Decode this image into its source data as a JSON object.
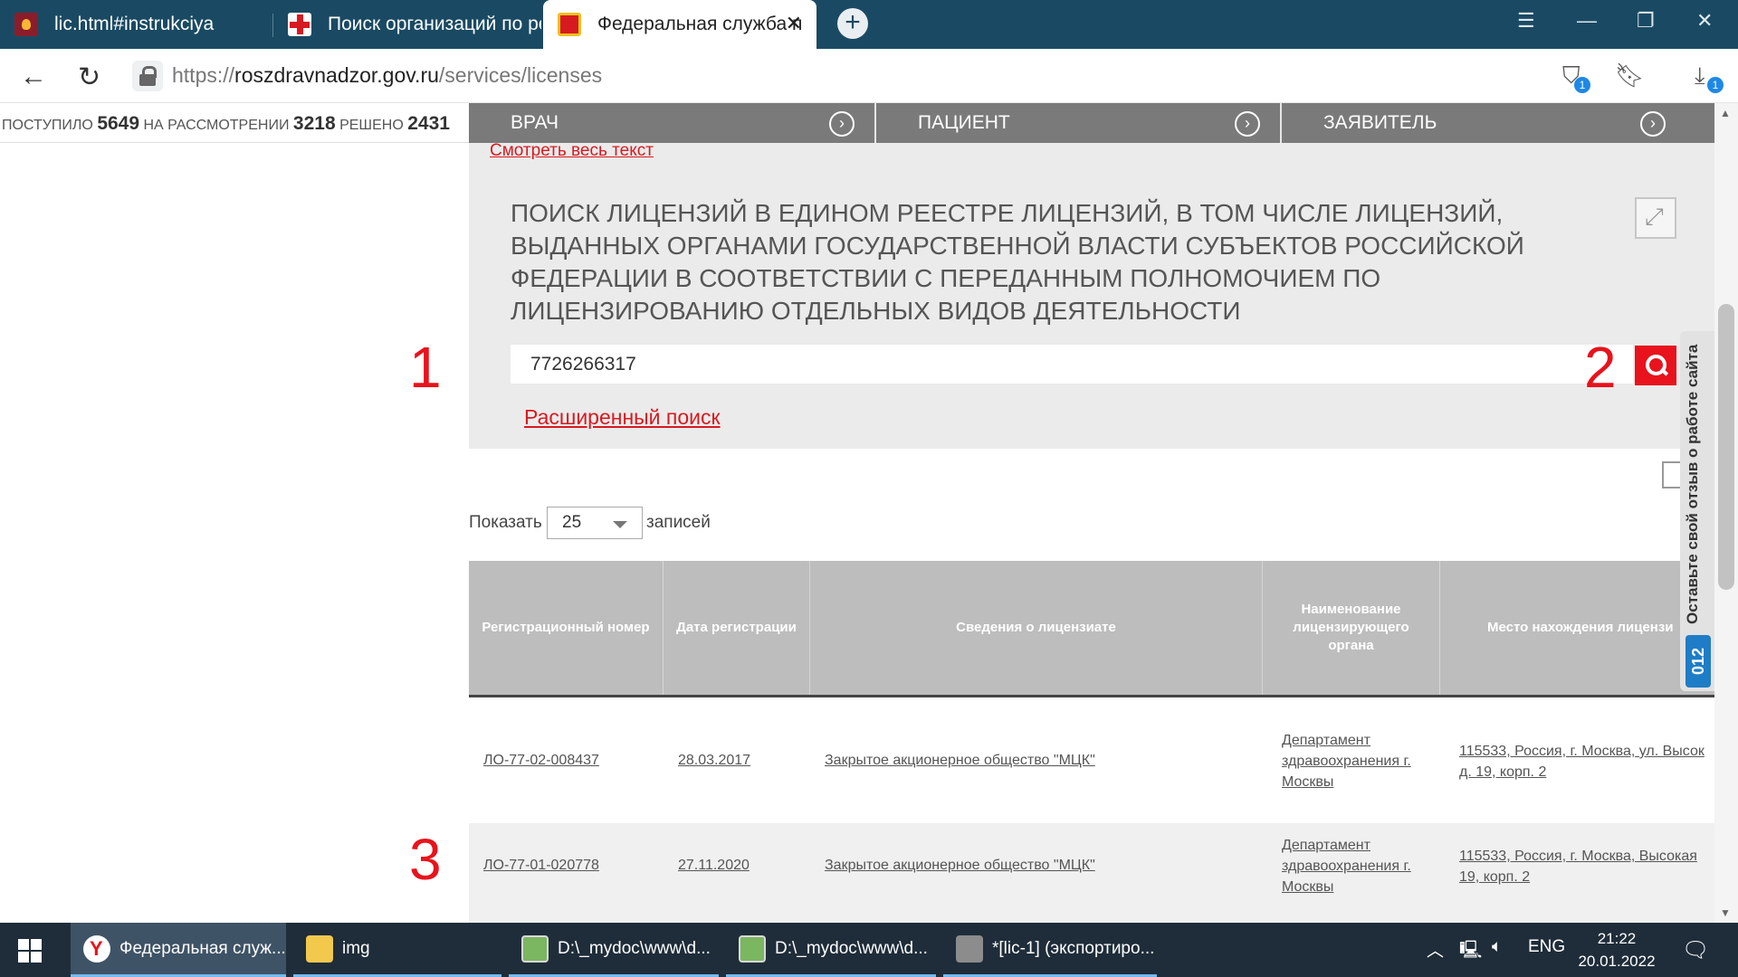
{
  "browser": {
    "tabs": [
      {
        "title": "lic.html#instrukciya"
      },
      {
        "title": "Поиск организаций по ре"
      },
      {
        "title": "Федеральная служба п"
      }
    ],
    "new_tab_label": "+",
    "url_scheme": "https://",
    "url_host": "roszdravnadzor.gov.ru",
    "url_path": "/services/licenses",
    "extension_badge": "1",
    "download_badge": "1"
  },
  "stats": {
    "received_label": "ПОСТУПИЛО",
    "received_value": "5649",
    "review_label": "НА РАССМОТРЕНИИ",
    "review_value": "3218",
    "solved_label": "РЕШЕНО",
    "solved_value": "2431"
  },
  "topnav": [
    "ВРАЧ",
    "ПАЦИЕНТ",
    "ЗАЯВИТЕЛЬ"
  ],
  "search": {
    "see_all_link": "Смотреть весь текст",
    "title": "Поиск лицензий в едином реестре лицензий, в том числе лицензий, выданных органами государственной власти субъектов Российской Федерации в соответствии с переданным полномочием по лицензированию отдельных видов деятельности",
    "query": "7726266317",
    "advanced_link": "Расширенный поиск"
  },
  "annotations": [
    "1",
    "2",
    "3"
  ],
  "table_controls": {
    "show_label": "Показать",
    "page_size": "25",
    "records_label": "записей"
  },
  "table": {
    "columns": [
      "Регистрационный номер",
      "Дата регистрации",
      "Сведения о лицензиате",
      "Наименование лицензирующего органа",
      "Место нахождения лицензи"
    ],
    "rows": [
      {
        "reg_number": "ЛО-77-02-008437",
        "reg_date": "28.03.2017",
        "licensee": "Закрытое акционерное общество \"МЦК\"",
        "authority_1": "Департамент",
        "authority_2": "здравоохранения г.",
        "authority_3": "Москвы",
        "address_1": "115533, Россия, г. Москва, ул. Высок",
        "address_2": "д. 19, корп. 2"
      },
      {
        "reg_number": "ЛО-77-01-020778",
        "reg_date": "27.11.2020",
        "licensee": "Закрытое акционерное общество \"МЦК\"",
        "authority_1": "Департамент",
        "authority_2": "здравоохранения г.",
        "authority_3": "Москвы",
        "address_1": "115533, Россия, г. Москва, Высокая",
        "address_2": "19, корп. 2"
      }
    ]
  },
  "feedback": {
    "text": "Оставьте свой отзыв о работе сайта",
    "badge": "012"
  },
  "taskbar": {
    "tasks": [
      "Федеральная служ...",
      "img",
      "D:\\_mydoc\\www\\d...",
      "D:\\_mydoc\\www\\d...",
      "*[lic-1] (экспортиро..."
    ],
    "language": "ENG",
    "time": "21:22",
    "date": "20.01.2022"
  }
}
